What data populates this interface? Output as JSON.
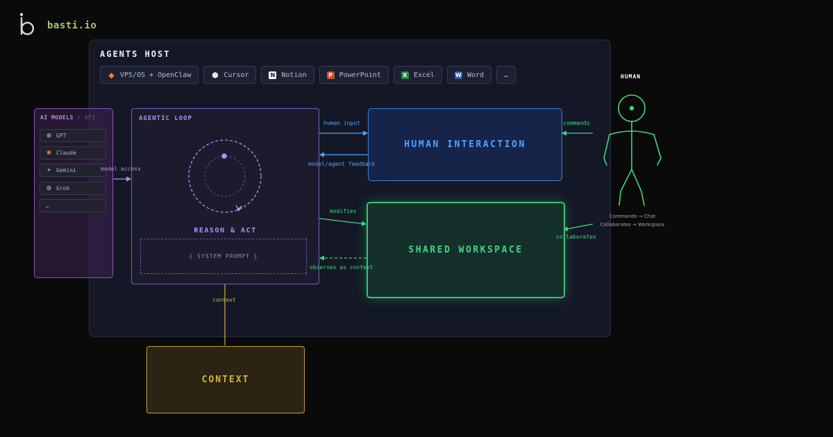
{
  "brand": {
    "name": "basti.io",
    "logo_icon": "b-logo-icon"
  },
  "agents_host": {
    "title": "AGENTS HOST",
    "tools": [
      {
        "label": "VPS/OS + OpenClaw",
        "icon": "openclaw-icon",
        "color": "#f2793a",
        "glyph": "◆"
      },
      {
        "label": "Cursor",
        "icon": "cursor-icon",
        "color": "#e8e8e8",
        "glyph": "⬢"
      },
      {
        "label": "Notion",
        "icon": "notion-icon",
        "color": "#ffffff",
        "glyph": "N"
      },
      {
        "label": "PowerPoint",
        "icon": "powerpoint-icon",
        "color": "#d14b2a",
        "glyph": "P"
      },
      {
        "label": "Excel",
        "icon": "excel-icon",
        "color": "#1f8a4c",
        "glyph": "X"
      },
      {
        "label": "Word",
        "icon": "word-icon",
        "color": "#2b5db8",
        "glyph": "W"
      },
      {
        "label": "…",
        "icon": "",
        "color": "",
        "glyph": ""
      }
    ]
  },
  "ai_models": {
    "title": "AI MODELS",
    "subtitle": "/ API",
    "items": [
      {
        "label": "GPT",
        "icon": "openai-icon",
        "glyph": "⊛",
        "color": "#cfcfd8"
      },
      {
        "label": "Claude",
        "icon": "claude-icon",
        "glyph": "✺",
        "color": "#e07a4f"
      },
      {
        "label": "Gemini",
        "icon": "gemini-icon",
        "glyph": "✦",
        "color": "#5b8cff"
      },
      {
        "label": "Grok",
        "icon": "grok-icon",
        "glyph": "⊘",
        "color": "#e0e0e0"
      },
      {
        "label": "…",
        "icon": "",
        "glyph": "",
        "color": ""
      }
    ]
  },
  "agentic_loop": {
    "title": "AGENTIC LOOP",
    "reason_label": "REASON & ACT",
    "system_prompt": "{ SYSTEM PROMPT }"
  },
  "human_interaction": {
    "title": "HUMAN INTERACTION"
  },
  "shared_workspace": {
    "title": "SHARED WORKSPACE"
  },
  "context": {
    "title": "CONTEXT"
  },
  "human": {
    "title": "HUMAN",
    "caption_line1": "Commands → Chat",
    "caption_line2": "Collaborates → Workspace"
  },
  "edges": {
    "model_access": "model access",
    "human_input": "human input",
    "model_agent_feedback": "model/agent feedback",
    "modifies": "modifies",
    "observes_as_context": "observes as context",
    "context": "context",
    "commands": "commands",
    "collaborates": "collaborates"
  },
  "colors": {
    "purple": "#b98cf6",
    "blue": "#4da3ff",
    "green": "#3fd97d",
    "gold": "#d9b13a"
  }
}
